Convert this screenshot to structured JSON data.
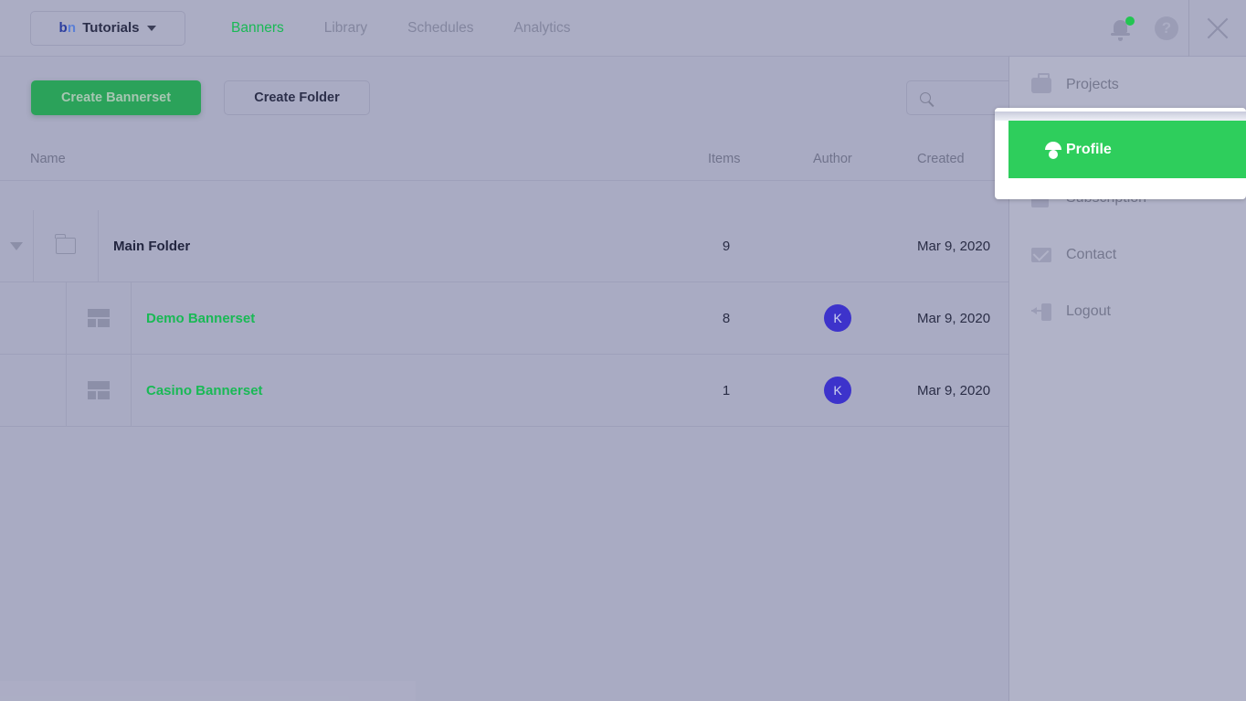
{
  "header": {
    "project_chip": {
      "logo_b": "b",
      "logo_n": "n",
      "project_name": "Tutorials",
      "caret_icon": "chevron-down-icon"
    },
    "nav": [
      {
        "label": "Banners",
        "active": true
      },
      {
        "label": "Library",
        "active": false
      },
      {
        "label": "Schedules",
        "active": false
      },
      {
        "label": "Analytics",
        "active": false
      }
    ],
    "actions": {
      "notifications_icon": "bell-icon",
      "notifications_badge": true,
      "help_icon": "help-circle-icon",
      "help_glyph": "?",
      "close_icon": "close-icon"
    }
  },
  "toolbar": {
    "create_bannerset_label": "Create Bannerset",
    "create_folder_label": "Create Folder",
    "search_placeholder": "",
    "search_value": "",
    "search_icon": "search-icon"
  },
  "table": {
    "columns": {
      "name": "Name",
      "items": "Items",
      "author": "Author",
      "created": "Created"
    },
    "rows": [
      {
        "type": "folder",
        "icon": "folder-icon",
        "expand_icon": "triangle-down-icon",
        "name": "Main Folder",
        "items": "9",
        "author": "",
        "created": "Mar 9, 2020"
      },
      {
        "type": "bannerset",
        "icon": "bannerset-layout-icon",
        "name": "Demo Bannerset",
        "items": "8",
        "author": "K",
        "created": "Mar 9, 2020"
      },
      {
        "type": "bannerset",
        "icon": "bannerset-layout-icon",
        "name": "Casino Bannerset",
        "items": "1",
        "author": "K",
        "created": "Mar 9, 2020"
      }
    ]
  },
  "side_panel": {
    "items": [
      {
        "label": "Projects",
        "icon": "briefcase-icon"
      },
      {
        "label": "Profile",
        "icon": "person-icon"
      },
      {
        "label": "Subscription",
        "icon": "shopping-bag-icon"
      },
      {
        "label": "Contact",
        "icon": "envelope-icon"
      },
      {
        "label": "Logout",
        "icon": "logout-icon"
      }
    ]
  },
  "highlight": {
    "label": "Profile",
    "icon": "person-icon"
  },
  "colors": {
    "accent_green": "#19b955",
    "highlight_green": "#2ece5c",
    "primary_button": "#2ba25a",
    "overlay_background": "#a9abc3",
    "panel_background": "#b1b3c8",
    "avatar": "#3d33cb",
    "logo_b": "#2b3d9e",
    "logo_n": "#5b7fd6",
    "text_dark": "#232640",
    "text_muted": "#75788f"
  }
}
